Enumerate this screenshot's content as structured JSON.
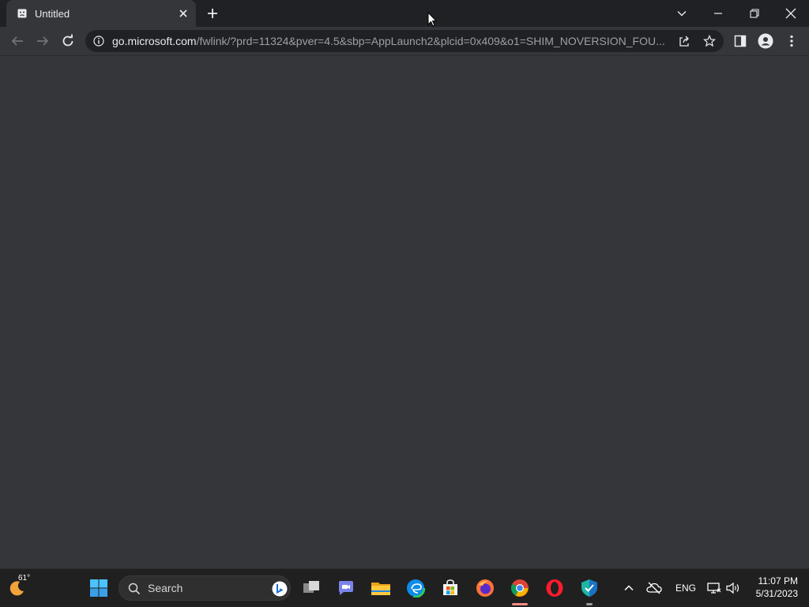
{
  "browser": {
    "tab": {
      "title": "Untitled"
    },
    "address": {
      "host": "go.microsoft.com",
      "path": "/fwlink/?prd=11324&pver=4.5&sbp=AppLaunch2&plcid=0x409&o1=SHIM_NOVERSION_FOU..."
    }
  },
  "taskbar": {
    "weather": {
      "temp": "61°"
    },
    "search": {
      "label": "Search"
    },
    "tray": {
      "language": "ENG"
    },
    "clock": {
      "time": "11:07 PM",
      "date": "5/31/2023"
    }
  },
  "colors": {
    "titlebar": "#202124",
    "page_background": "#35363a",
    "taskbar": "#202020",
    "active_indicator": "#f28b82"
  }
}
